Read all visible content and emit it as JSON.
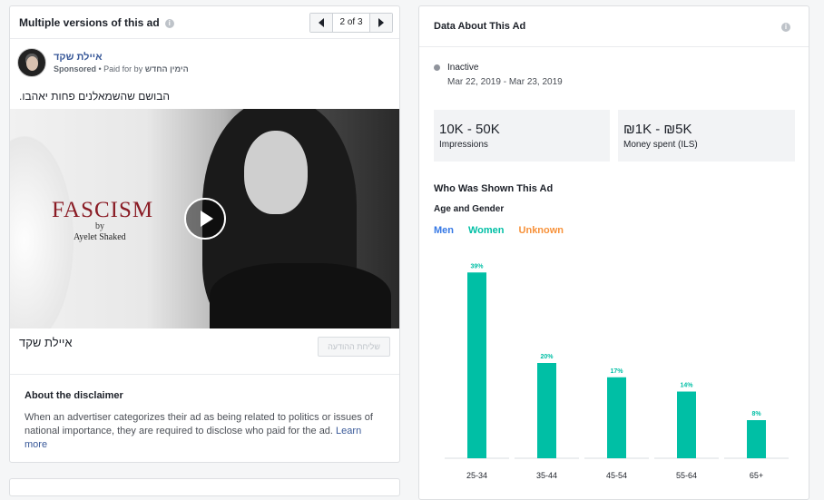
{
  "left_panel": {
    "title": "Multiple versions of this ad",
    "info_icon": "info-icon",
    "pager": {
      "prev_icon": "chevron-left-icon",
      "count": "2 of 3",
      "next_icon": "chevron-right-icon"
    },
    "post": {
      "page_name": "איילת שקד",
      "sponsored_label": "Sponsored",
      "paid_for_prefix": " • Paid for by ",
      "paid_for_name": "הימין החדש",
      "ad_text": "הבושם שהשמאלנים פחות יאהבו.",
      "image": {
        "brand": "FASCISM",
        "brand_by": "by",
        "brand_sub": "Ayelet Shaked",
        "play_icon": "play-icon"
      },
      "caption": "איילת שקד",
      "send_button": "שליחת ההודעה"
    },
    "disclaimer": {
      "title": "About the disclaimer",
      "text": "When an advertiser categorizes their ad as being related to politics or issues of national importance, they are required to disclose who paid for the ad.",
      "learn_more": "Learn more"
    }
  },
  "right_panel": {
    "title": "Data About This Ad",
    "info_icon": "info-icon",
    "status": "Inactive",
    "dates": "Mar 22, 2019 - Mar 23, 2019",
    "impressions": {
      "value": "10K - 50K",
      "label": "Impressions"
    },
    "spend": {
      "value": "₪1K - ₪5K",
      "label": "Money spent (ILS)"
    },
    "shown_title": "Who Was Shown This Ad",
    "age_gender_title": "Age and Gender",
    "legend": {
      "men": "Men",
      "women": "Women",
      "unknown": "Unknown"
    },
    "colors": {
      "men": "#3578e5",
      "women": "#00bfa5",
      "unknown": "#f7923b",
      "status_inactive": "#90949c"
    }
  },
  "chart_data": {
    "type": "bar",
    "categories": [
      "25-34",
      "35-44",
      "45-54",
      "55-64",
      "65+"
    ],
    "series": [
      {
        "name": "Women",
        "values": [
          39,
          20,
          17,
          14,
          8
        ]
      }
    ],
    "value_labels": [
      "39%",
      "20%",
      "17%",
      "14%",
      "8%"
    ],
    "ylim": [
      0,
      40
    ]
  }
}
